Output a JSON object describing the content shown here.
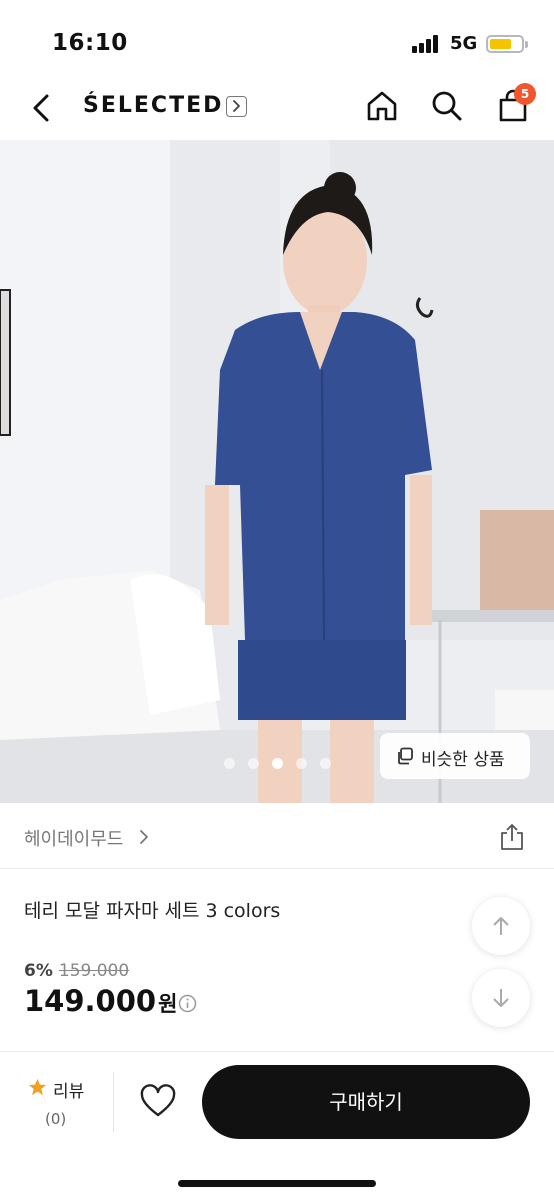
{
  "status_bar": {
    "time": "16:10",
    "network": "5G",
    "battery_level": 0.7,
    "battery_color": "#f5c400"
  },
  "nav": {
    "back_icon": "chevron-left-icon",
    "brand": "ŚELECTED",
    "brand_chevron_icon": "chevron-right-box-icon",
    "home_icon": "home-icon",
    "search_icon": "search-icon",
    "cart_icon": "shopping-bag-icon",
    "cart_badge": "5",
    "badge_color": "#f2562f"
  },
  "gallery": {
    "image_count": 5,
    "active_index": 2,
    "similar_button_label": "비슷한 상품",
    "similar_icon": "copy-icon"
  },
  "store": {
    "name": "헤이데이무드",
    "chevron_icon": "chevron-right-icon",
    "share_icon": "share-icon"
  },
  "product": {
    "title": "테리 모달 파자마 세트 3 colors",
    "discount_rate": "6%",
    "original_price": "159.000",
    "price": "149.000",
    "currency_unit": "원",
    "info_icon": "info-icon",
    "scroll_up_icon": "arrow-up-icon",
    "scroll_down_icon": "arrow-down-icon"
  },
  "bottom_bar": {
    "review_label": "리뷰",
    "review_count": "(0)",
    "star_icon": "star-icon",
    "star_color": "#f0a020",
    "like_icon": "heart-icon",
    "buy_label": "구매하기"
  }
}
